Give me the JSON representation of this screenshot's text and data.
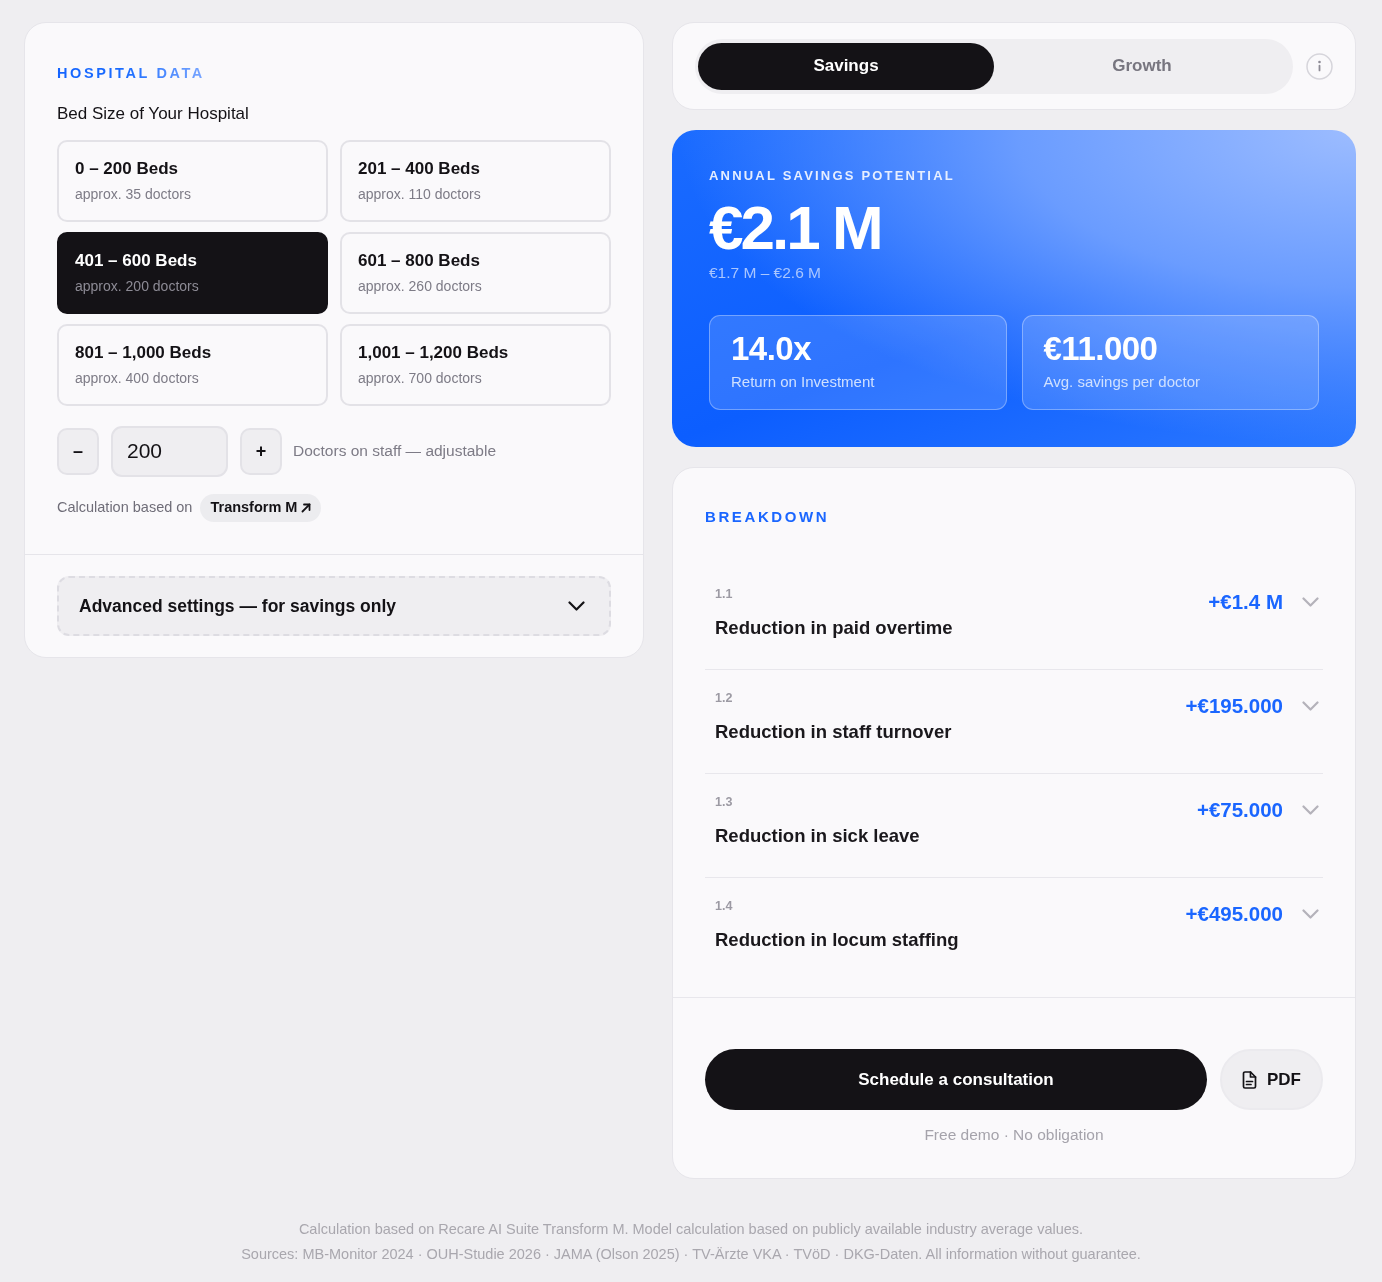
{
  "hospital_data": {
    "heading": "HOSPITAL DATA",
    "label": "Bed Size of Your Hospital",
    "bed_sizes": [
      {
        "title": "0 – 200 Beds",
        "subtitle": "approx. 35 doctors",
        "selected": false
      },
      {
        "title": "201 – 400 Beds",
        "subtitle": "approx. 110 doctors",
        "selected": false
      },
      {
        "title": "401 – 600 Beds",
        "subtitle": "approx. 200 doctors",
        "selected": true
      },
      {
        "title": "601 – 800 Beds",
        "subtitle": "approx. 260 doctors",
        "selected": false
      },
      {
        "title": "801 – 1,000 Beds",
        "subtitle": "approx. 400 doctors",
        "selected": false
      },
      {
        "title": "1,001 – 1,200 Beds",
        "subtitle": "approx. 700 doctors",
        "selected": false
      }
    ],
    "doctors_stepper": {
      "decrement": "–",
      "value": "200",
      "increment": "+",
      "hint": "Doctors on staff — adjustable"
    },
    "calculation_note": {
      "text": "Calculation based on",
      "link": "Transform M"
    },
    "advanced_settings": {
      "label": "Advanced settings — for savings only",
      "expanded": false
    }
  },
  "mode_tabs": [
    {
      "label": "Savings",
      "selected": true
    },
    {
      "label": "Growth",
      "selected": false
    }
  ],
  "savings_card": {
    "eyebrow": "ANNUAL SAVINGS POTENTIAL",
    "amount": "€2.1 M",
    "range": "€1.7 M – €2.6 M",
    "stats": [
      {
        "value": "14.0x",
        "label": "Return on Investment"
      },
      {
        "value": "€11.000",
        "label": "Avg. savings per doctor"
      }
    ]
  },
  "breakdown": {
    "heading": "BREAKDOWN",
    "items": [
      {
        "number": "1.1",
        "title": "Reduction in paid overtime",
        "amount": "+€1.4 M",
        "expanded": false
      },
      {
        "number": "1.2",
        "title": "Reduction in staff turnover",
        "amount": "+€195.000",
        "expanded": false
      },
      {
        "number": "1.3",
        "title": "Reduction in sick leave",
        "amount": "+€75.000",
        "expanded": false
      },
      {
        "number": "1.4",
        "title": "Reduction in locum staffing",
        "amount": "+€495.000",
        "expanded": false
      }
    ]
  },
  "actions": {
    "primary": "Schedule a consultation",
    "pdf": "PDF",
    "note": "Free demo · No obligation"
  },
  "footer": [
    "Calculation based on Recare AI Suite Transform M. Model calculation based on publicly available industry average values.",
    "Sources: MB-Monitor 2024 · OUH-Studie 2026 · JAMA (Olson 2025) · TV-Ärzte VKA · TVöD · DKG-Daten. All information without guarantee."
  ]
}
